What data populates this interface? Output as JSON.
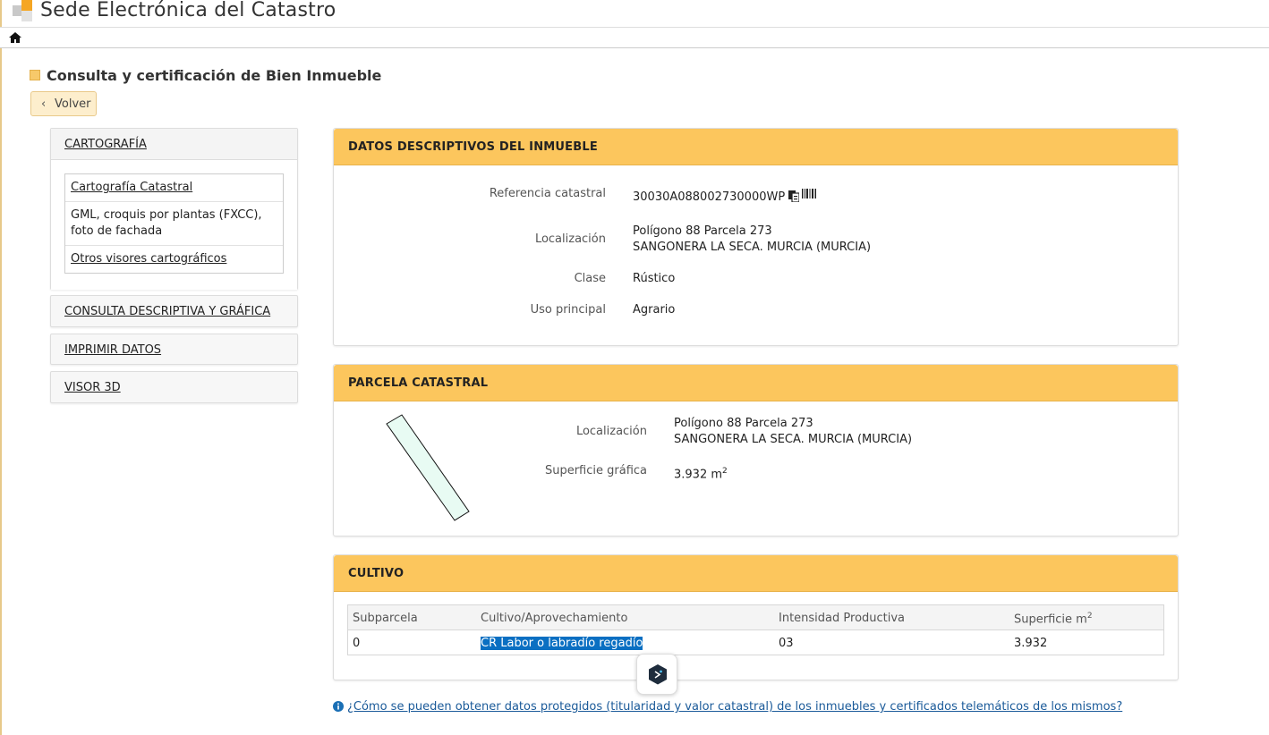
{
  "app": {
    "title": "Sede Electrónica del Catastro"
  },
  "page": {
    "title": "Consulta y certificación de Bien Inmueble",
    "back_label": "Volver"
  },
  "sidebar": {
    "cartografia": {
      "label": "CARTOGRAFÍA",
      "items": [
        {
          "label": "Cartografía Catastral"
        },
        {
          "label": "GML, croquis por plantas (FXCC), foto de fachada"
        },
        {
          "label": "Otros visores cartográficos"
        }
      ]
    },
    "consulta": {
      "label": "CONSULTA DESCRIPTIVA Y GRÁFICA"
    },
    "imprimir": {
      "label": "IMPRIMIR DATOS"
    },
    "visor": {
      "label": "VISOR 3D"
    }
  },
  "datos": {
    "heading": "DATOS DESCRIPTIVOS DEL INMUEBLE",
    "ref_label": "Referencia catastral",
    "ref_value": "30030A088002730000WP",
    "loc_label": "Localización",
    "loc_line1": "Polígono 88 Parcela 273",
    "loc_line2": "SANGONERA LA SECA. MURCIA (MURCIA)",
    "clase_label": "Clase",
    "clase_value": "Rústico",
    "uso_label": "Uso principal",
    "uso_value": "Agrario"
  },
  "parcela": {
    "heading": "PARCELA CATASTRAL",
    "loc_label": "Localización",
    "loc_line1": "Polígono 88 Parcela 273",
    "loc_line2": "SANGONERA LA SECA. MURCIA (MURCIA)",
    "sup_label": "Superficie gráfica",
    "sup_value": "3.932 m",
    "sup_unit_sup": "2"
  },
  "cultivo": {
    "heading": "CULTIVO",
    "columns": [
      "Subparcela",
      "Cultivo/Aprovechamiento",
      "Intensidad Productiva",
      "Superficie m"
    ],
    "col_sup": "2",
    "rows": [
      {
        "subparcela": "0",
        "cultivo": "CR Labor o labradío regadío",
        "intensidad": "03",
        "superficie": "3.932"
      }
    ]
  },
  "footer": {
    "info_link": "¿Cómo se pueden obtener datos protegidos (titularidad y valor catastral) de los inmuebles y certificados telemáticos de los mismos?"
  },
  "colors": {
    "accent": "#fcc65d",
    "link": "#1a5a99",
    "selection": "#0a6fc2",
    "parcel_fill": "#e8fbf3"
  },
  "icons": [
    "home-icon",
    "copy-icon",
    "barcode-icon",
    "info-icon",
    "chevron-left-icon",
    "chat-assistant-icon"
  ]
}
